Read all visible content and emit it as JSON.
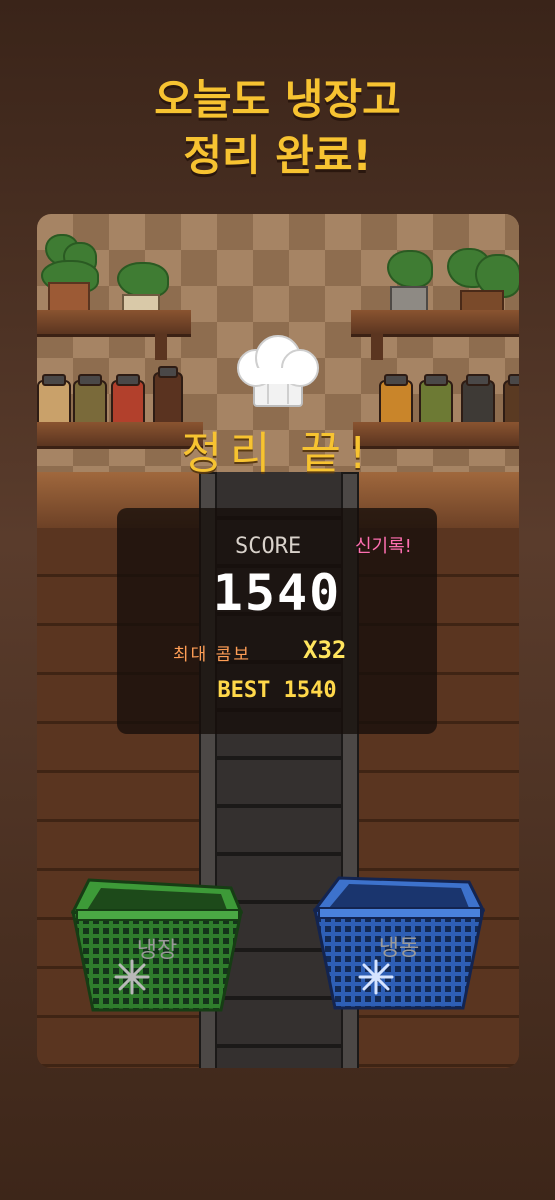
{
  "headline": {
    "line1": "오늘도 냉장고",
    "line2": "정리 완료!"
  },
  "game": {
    "title": "정리 끝!",
    "icon": "chef-hat-icon",
    "score_panel": {
      "score_label": "SCORE",
      "new_record": "신기록!",
      "score": "1540",
      "combo_label": "최대 콤보",
      "combo_value": "X32",
      "best": "BEST 1540"
    },
    "baskets": {
      "fridge": {
        "label": "냉장",
        "color": "#2f7d2c",
        "icon": "snowflake-icon"
      },
      "freezer": {
        "label": "냉동",
        "color": "#2e5fb6",
        "icon": "snowflake-icon"
      }
    }
  },
  "colors": {
    "accent": "#f7c331",
    "record": "#ff6fb1",
    "combo": "#ff9e56"
  }
}
